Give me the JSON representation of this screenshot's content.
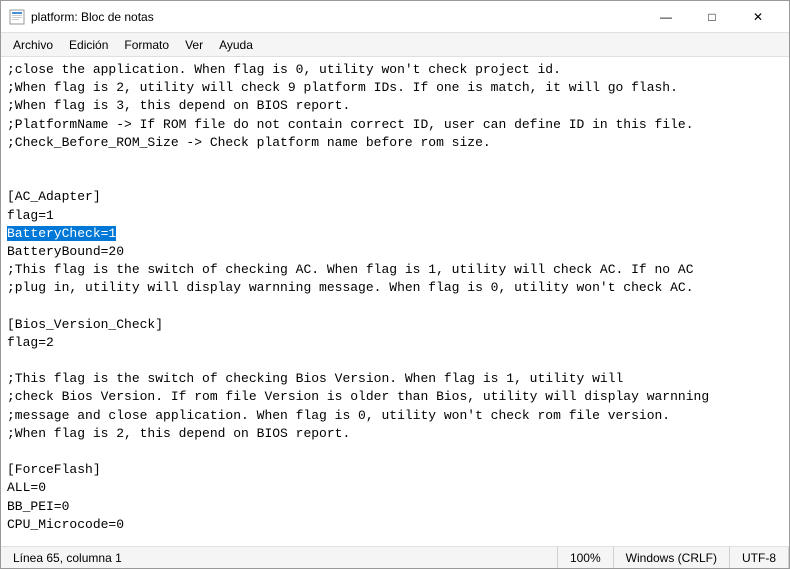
{
  "window": {
    "title": "platform: Bloc de notas",
    "icon": "notepad"
  },
  "menu": {
    "items": [
      "Archivo",
      "Edición",
      "Formato",
      "Ver",
      "Ayuda"
    ]
  },
  "editor": {
    "content_before_highlight": ";close the application. When flag is 0, utility won't check project id.\n;When flag is 2, utility will check 9 platform IDs. If one is match, it will go flash.\n;When flag is 3, this depend on BIOS report.\n;PlatformName -> If ROM file do not contain correct ID, user can define ID in this file.\n;Check_Before_ROM_Size -> Check platform name before rom size.\n\n\n[AC_Adapter]\nflag=1\n",
    "highlighted_text": "BatteryCheck=1",
    "content_after_highlight": "\nBatteryBound=20\n;This flag is the switch of checking AC. When flag is 1, utility will check AC. If no AC\n;plug in, utility will display warnning message. When flag is 0, utility won't check AC.\n\n[Bios_Version_Check]\nflag=2\n\n;This flag is the switch of checking Bios Version. When flag is 1, utility will\n;check Bios Version. If rom file Version is older than Bios, utility will display warnning\n;message and close application. When flag is 0, utility won't check rom file version.\n;When flag is 2, this depend on BIOS report.\n\n[ForceFlash]\nALL=0\nBB_PEI=0\nCPU_Microcode=0"
  },
  "status_bar": {
    "position": "Línea 65, columna 1",
    "zoom": "100%",
    "line_ending": "Windows (CRLF)",
    "encoding": "UTF-8"
  },
  "title_buttons": {
    "minimize": "—",
    "maximize": "□",
    "close": "✕"
  }
}
